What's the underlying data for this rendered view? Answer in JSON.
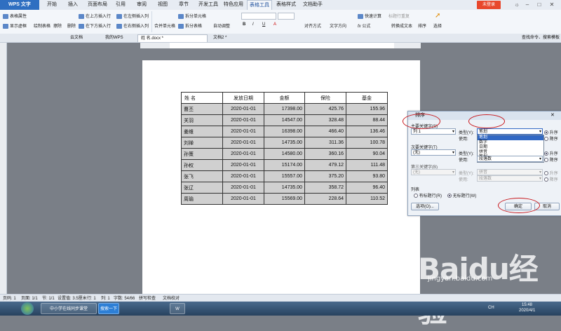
{
  "titlebar": {
    "app": "WPS 文字",
    "menus": [
      "开始",
      "插入",
      "页面布局",
      "引用",
      "审阅",
      "视图",
      "章节",
      "开发工具",
      "特色应用",
      "表格工具",
      "表格样式",
      "文档助手"
    ],
    "active_menu": "表格工具",
    "login": "未登录"
  },
  "ribbon": {
    "table_props": "表格属性",
    "show_grid": "显示虚框",
    "draw_table": "绘制表格",
    "erase": "擦除",
    "delete": "删除",
    "insert_above": "在上方插入行",
    "insert_below": "在下方插入行",
    "insert_left": "在左侧插入列",
    "insert_right": "在右侧插入列",
    "merge_cells": "合并单元格",
    "split_cells": "拆分单元格",
    "split_table": "拆分表格",
    "auto_adjust": "自动调整",
    "align": "对齐方式",
    "text_direction": "文字方向",
    "quick_calc": "快速计算",
    "title_repeat": "标题行重复",
    "formula": "公式",
    "to_text": "转换成文本",
    "sort": "排序",
    "select": "选择"
  },
  "tabs": {
    "cloud": "云文档",
    "mywps": "我的WPS",
    "doc1": "姓 名.docx *",
    "doc2": "文档2 *",
    "search_hint": "查找命令、搜索模板"
  },
  "table": {
    "headers": [
      "姓  名",
      "发放日期",
      "金额",
      "保险",
      "基金"
    ],
    "rows": [
      [
        "曹丕",
        "2020-01-01",
        "17398.00",
        "425.76",
        "155.96"
      ],
      [
        "关羽",
        "2020-01-01",
        "14547.00",
        "328.48",
        "88.44"
      ],
      [
        "姜维",
        "2020-01-01",
        "16398.00",
        "466.40",
        "136.46"
      ],
      [
        "刘禅",
        "2020-01-01",
        "14735.00",
        "311.36",
        "100.78"
      ],
      [
        "孙策",
        "2020-01-01",
        "14580.00",
        "360.16",
        "90.04"
      ],
      [
        "孙权",
        "2020-01-01",
        "15174.00",
        "479.12",
        "111.48"
      ],
      [
        "张飞",
        "2020-01-01",
        "15557.00",
        "375.20",
        "93.80"
      ],
      [
        "张辽",
        "2020-01-01",
        "14735.00",
        "358.72",
        "96.40"
      ],
      [
        "周瑜",
        "2020-01-01",
        "15569.00",
        "228.64",
        "110.52"
      ]
    ]
  },
  "dialog": {
    "title": "排序",
    "primary_key": "主要关键字(S)",
    "primary_value": "列 1",
    "type_label": "类型(Y):",
    "type_value": "笔划",
    "type_options": [
      "笔划",
      "数字",
      "日期",
      "拼音",
      "笔划"
    ],
    "using_label": "使用:",
    "asc": "升序",
    "desc": "降序",
    "secondary_key": "次要关键字(T)",
    "secondary_value": "(无)",
    "secondary_type": "拼音",
    "secondary_using": "段落数",
    "tertiary_key": "第三关键字(B)",
    "tertiary_value": "(无)",
    "tertiary_type": "拼音",
    "tertiary_using": "段落数",
    "list_label": "列表",
    "has_header": "有标题行(R)",
    "no_header": "无标题行(W)",
    "options_button": "选项(O)...",
    "ok_button": "确定",
    "cancel_button": "取消"
  },
  "statusbar": {
    "page_num": "页码: 1",
    "page": "页面: 1/1",
    "section": "节: 1/1",
    "setting": "设置值: 3.5厘米",
    "row": "行: 1",
    "col": "列: 1",
    "words": "字数: 54/66",
    "spell": "拼写检查",
    "doc_check": "文档校对"
  },
  "taskbar": {
    "ie_task": "中小学在线同步课堂",
    "search_btn": "搜索一下",
    "time": "15:48",
    "date": "2020/4/1",
    "lang": "CH"
  },
  "watermark": {
    "main": "Baidu经验",
    "sub": "jingyan.baidu.com"
  },
  "colors": {
    "accent": "#2f6fc1",
    "annotation": "#c8191e",
    "login": "#e8472c"
  }
}
